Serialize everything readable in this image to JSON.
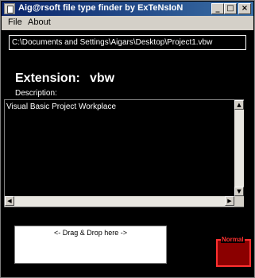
{
  "window": {
    "title": "Aig@rsoft file type finder by ExTeNsIoN",
    "controls": {
      "minimize": "_",
      "maximize": "□",
      "close": "×"
    }
  },
  "menu": {
    "items": [
      "File",
      "About"
    ]
  },
  "path": {
    "value": "C:\\Documents and Settings\\Aigars\\Desktop\\Project1.vbw"
  },
  "extension": {
    "label": "Extension:",
    "value": "vbw"
  },
  "description": {
    "label": "Description:",
    "text": "Visual Basic Project Workplace"
  },
  "scroll": {
    "up": "▲",
    "down": "▼",
    "left": "◀",
    "right": "▶"
  },
  "drop_zone": {
    "text": "<- Drag & Drop here ->"
  },
  "status": {
    "label": "Normal",
    "color": "#8b0000"
  }
}
